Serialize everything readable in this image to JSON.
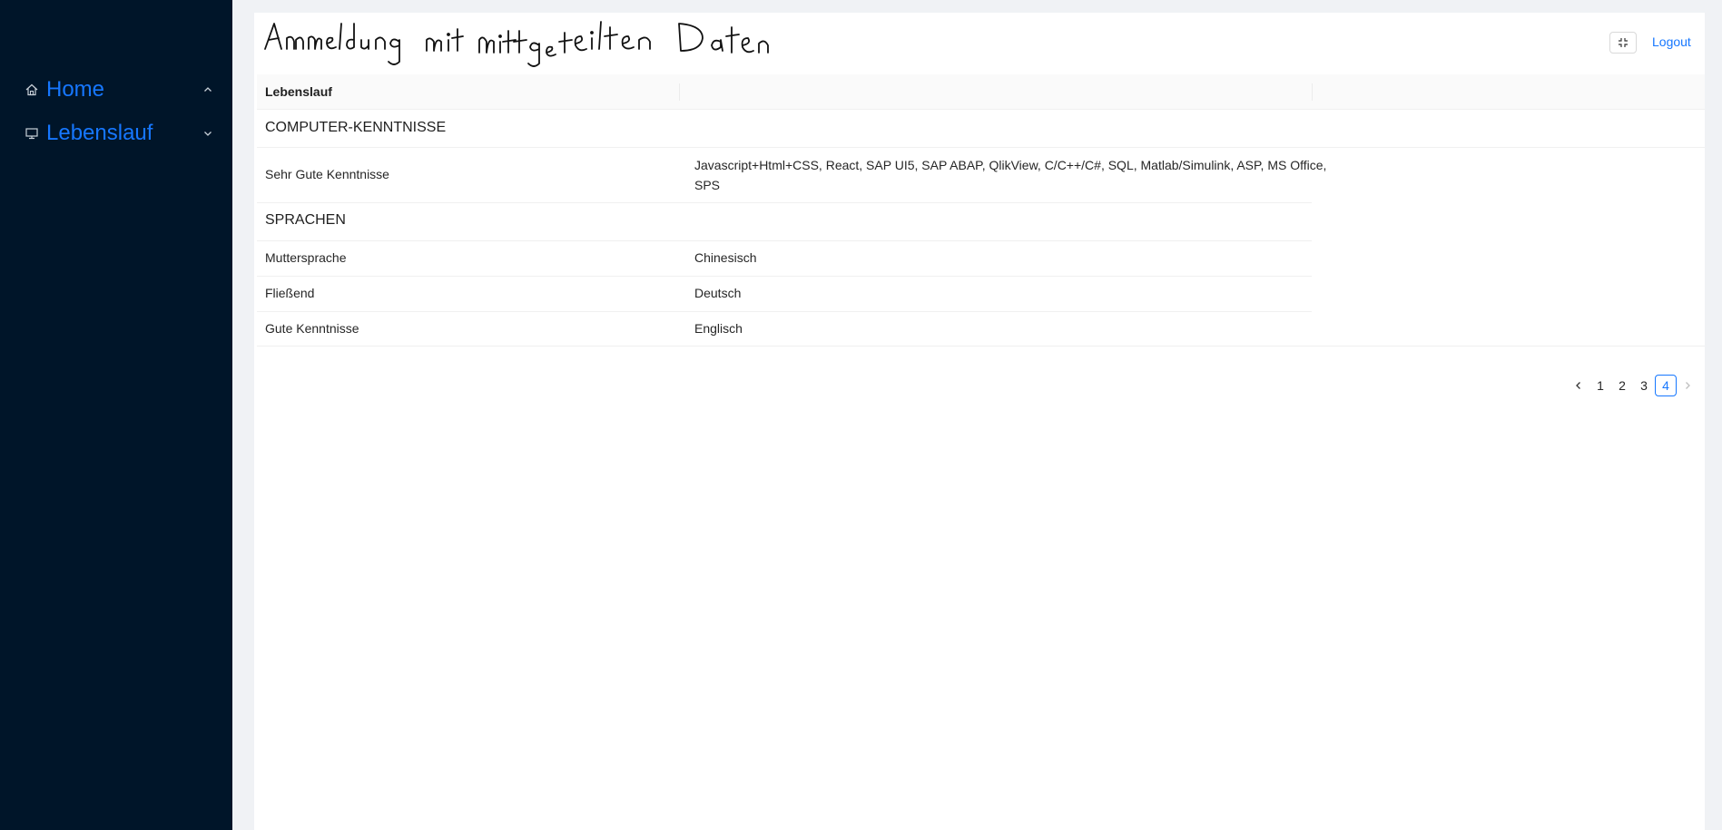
{
  "sidebar": {
    "items": [
      {
        "label": "Home",
        "icon": "home-icon",
        "arrow": "chevron-up-icon"
      },
      {
        "label": "Lebenslauf",
        "icon": "desktop-icon",
        "arrow": "chevron-down-icon"
      }
    ]
  },
  "header": {
    "handwritten_title": "Anmeldung mit mitgeteilten Daten",
    "fullscreen_icon": "fullscreen-exit-icon",
    "logout_label": "Logout"
  },
  "table": {
    "columns": [
      "Lebenslauf",
      "",
      ""
    ],
    "sections": [
      {
        "title": "COMPUTER-KENNTNISSE",
        "rows": [
          {
            "label": "Sehr Gute Kenntnisse",
            "value": "Javascript+Html+CSS, React, SAP UI5, SAP ABAP, QlikView, C/C++/C#, SQL, Matlab/Simulink, ASP, MS Office, SPS"
          }
        ]
      },
      {
        "title": "SPRACHEN",
        "rows": [
          {
            "label": "Muttersprache",
            "value": "Chinesisch"
          },
          {
            "label": "Fließend",
            "value": "Deutsch"
          },
          {
            "label": "Gute Kenntnisse",
            "value": "Englisch"
          }
        ]
      }
    ]
  },
  "pagination": {
    "pages": [
      "1",
      "2",
      "3",
      "4"
    ],
    "current": "4"
  },
  "colors": {
    "sidebar_bg": "#001529",
    "accent": "#1677ff",
    "page_bg": "#f0f2f5"
  }
}
